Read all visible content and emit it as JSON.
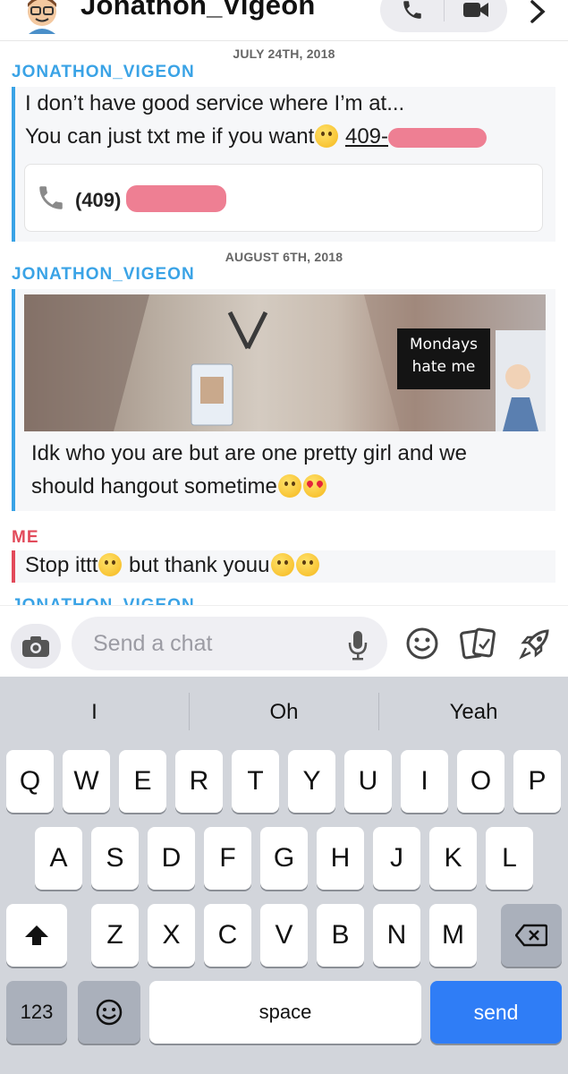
{
  "header": {
    "name": "Jonathon_Vigeon"
  },
  "chat": {
    "date1": "JULY 24TH, 2018",
    "sender1": "JONATHON_VIGEON",
    "msg1_line1": "I don’t have good service where I’m at...",
    "msg1_line2_text": "You can just txt me if you want",
    "msg1_phone_prefix": "409-",
    "contact_prefix": "(409)",
    "date2": "AUGUST 6TH, 2018",
    "sender2": "JONATHON_VIGEON",
    "sticker_text_1": "Mondays",
    "sticker_text_2": "hate me",
    "msg2_line1": "Idk who you are but are one pretty girl and we",
    "msg2_line2": "should hangout sometime",
    "sender3": "ME",
    "msg3_part1": "Stop ittt",
    "msg3_part2": " but thank youu",
    "sender4_partial": "JONATHON_VIGEON"
  },
  "composer": {
    "placeholder": "Send a chat"
  },
  "keyboard": {
    "suggestions": [
      "I",
      "Oh",
      "Yeah"
    ],
    "row1": [
      "Q",
      "W",
      "E",
      "R",
      "T",
      "Y",
      "U",
      "I",
      "O",
      "P"
    ],
    "row2": [
      "A",
      "S",
      "D",
      "F",
      "G",
      "H",
      "J",
      "K",
      "L"
    ],
    "row3": [
      "Z",
      "X",
      "C",
      "V",
      "B",
      "N",
      "M"
    ],
    "numbers_label": "123",
    "space_label": "space",
    "send_label": "send"
  },
  "colors": {
    "sender_them": "#3aa3e6",
    "sender_me": "#e24a5a",
    "send_key": "#2f7df6"
  }
}
